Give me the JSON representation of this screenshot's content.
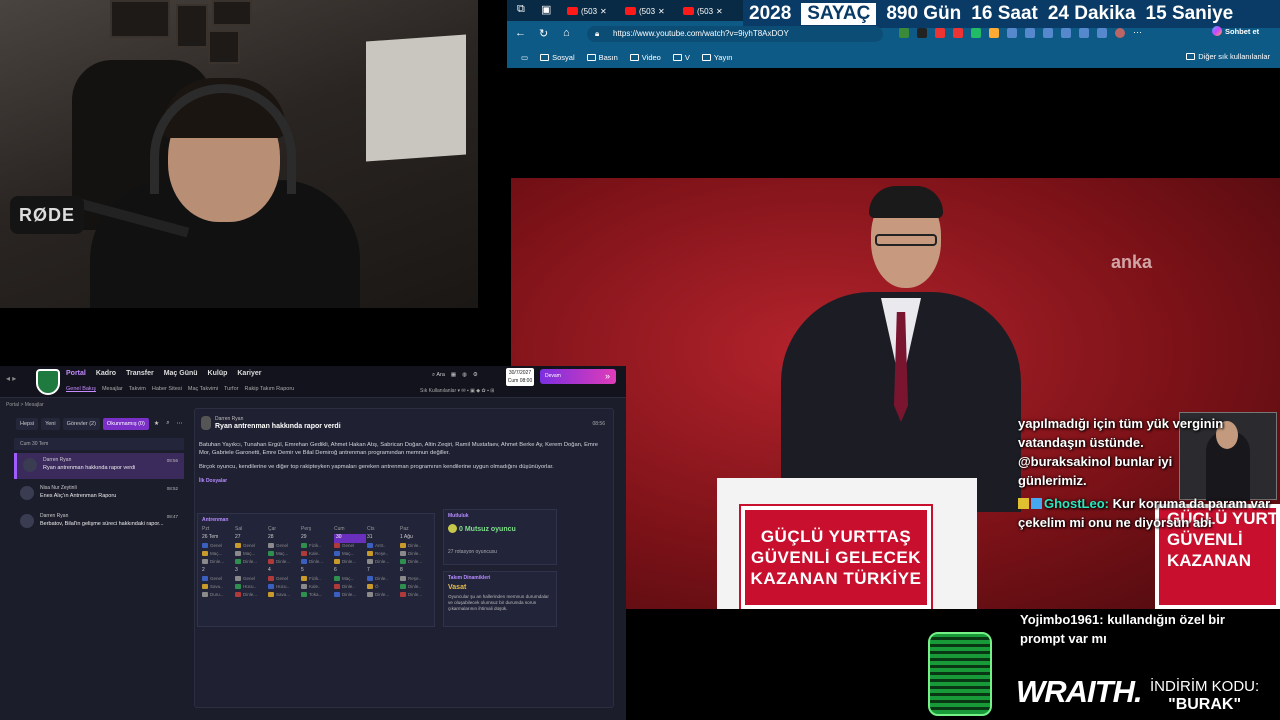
{
  "webcam": {
    "mic_brand": "RØDE"
  },
  "fm": {
    "nav": [
      "Portal",
      "Kadro",
      "Transfer",
      "Maç Günü",
      "Kulüp",
      "Kariyer"
    ],
    "subnav": [
      "Genel Bakış",
      "Mesajlar",
      "Takvim",
      "Haber Sitesi",
      "Maç Takvimi",
      "Turfor",
      "Rakip Takım Raporu"
    ],
    "search_label": "Ara",
    "date_line1": "30/7/2027",
    "date_line2": "Cum 08:00",
    "continue_label": "Devam",
    "filter_label": "Sık Kullanılanlar",
    "breadcrumb": "Portal > Mesajlar",
    "filters": [
      "Hepsi",
      "Yeni",
      "Görevler (2)",
      "Okunmamış (0)"
    ],
    "inbox_header": "Cum 30 Tem",
    "messages": [
      {
        "from": "Darren Ryan",
        "title": "Ryan antrenman hakkında rapor verdi",
        "time": "08:56",
        "selected": true
      },
      {
        "from": "Nisa Nur Zeytinli",
        "title": "Enes Alıç'ın Antrenman Raporu",
        "time": "08:52",
        "selected": false
      },
      {
        "from": "Darren Ryan",
        "title": "Berbatov, Bilal'in gelişme süreci hakkındaki rapor...",
        "time": "08:47",
        "selected": false
      }
    ],
    "detail": {
      "sender": "Darren Ryan",
      "subject": "Ryan antrenman hakkında rapor verdi",
      "time": "08:56",
      "paragraph1": "Batuhan Yayıkcı, Tunahan Ergül, Emrehan Gedikli, Ahmet Hakan Atış, Sabrican Doğan, Altin Zeqiri, Ramil Mustafaev, Ahmet Berke Ay, Kerem Doğan, Emre Mor, Gabriele Garonetti, Emre Demir ve Bilal Demiroğ antrenman programından memnun değiller.",
      "paragraph2": "Birçok oyuncu, kendilerine ve diğer top rakipteyken yapmaları gereken antrenman programının kendilerine uygun olmadığını düşünüyorlar.",
      "section": "İlk Dosyalar",
      "calendar_title": "Antrenman",
      "weekdays": [
        "Pzt",
        "Sal",
        "Çar",
        "Perş",
        "Cum",
        "Cts",
        "Paz"
      ],
      "week1": [
        "26 Tem",
        "27",
        "28",
        "29",
        "30",
        "31",
        "1 Ağu"
      ],
      "week1_slots": [
        [
          "Genel",
          "Maç...",
          "Dinle..."
        ],
        [
          "Genel",
          "Maç...",
          "Dinle..."
        ],
        [
          "Genel",
          "Maç...",
          "Dinle..."
        ],
        [
          "Fizik..",
          "Kale..",
          "Dinle..."
        ],
        [
          "Genel",
          "Maç...",
          "Dinle..."
        ],
        [
          "Antr..",
          "Reşe..",
          "Dinle..."
        ],
        [
          "Dinle..",
          "Dinle..",
          "Dinle..."
        ]
      ],
      "week2": [
        "2",
        "3",
        "4",
        "5",
        "6",
        "7",
        "8"
      ],
      "week2_slots": [
        [
          "Genel",
          "Savu..",
          "Duru..."
        ],
        [
          "Genel",
          "Hücu..",
          "Dinle..."
        ],
        [
          "Genel",
          "Hücu..",
          "Savu..."
        ],
        [
          "Fizik..",
          "Kale..",
          "Toka..."
        ],
        [
          "Maç...",
          "Dinle..",
          "Dinle..."
        ],
        [
          "Dinle..",
          "Ö",
          "Dinle..."
        ],
        [
          "Reşe..",
          "Dinle..",
          "Dinle..."
        ]
      ],
      "morale_title": "Mutluluk",
      "morale_value": "0 Mutsuz oyuncu",
      "morale_footer": "27 rotasyon oyuncusu",
      "team_title": "Takım Dinamikleri",
      "team_value": "Vasat",
      "team_desc": "Oyuncular şu an hallerinden memnun durumdalar ve oluşabilecek olumsuz bir durumda sorun çıkarmalarının ihtimali düşük."
    }
  },
  "browser": {
    "tabs": [
      "(503",
      "(503",
      "(503"
    ],
    "counter": {
      "year": "2028",
      "label": "SAYAÇ",
      "days": "890 Gün",
      "hours": "16 Saat",
      "minutes": "24 Dakika",
      "seconds": "15 Saniye"
    },
    "url": "https://www.youtube.com/watch?v=9iyhT8AxDOY",
    "chat_button": "Sohbet et",
    "bookmarks": [
      "Sosyal",
      "Basın",
      "Video",
      "V",
      "Yayın"
    ],
    "bookmarks_right": "Diğer sık kullanılanlar"
  },
  "video": {
    "watermark": "anka",
    "podium_lines": [
      "GÜÇLÜ YURTTAŞ",
      "GÜVENLİ GELECEK",
      "KAZANAN TÜRKİYE"
    ],
    "podium2_lines": [
      "GÜÇLÜ YURT",
      "GÜVENLİ",
      "KAZANAN"
    ]
  },
  "chat": {
    "line1": "yapılmadığı için tüm yük verginin",
    "line2": "vatandaşın üstünde.",
    "line3": "@buraksakinol bunlar iyi",
    "line4": "günlerimiz.",
    "user2": "GhostLeo:",
    "msg2": "Kur koruma da param var çekelim mi onu ne diyorsun abi",
    "user3": "Yojimbo1961:",
    "msg3": "kullandığın özel bir prompt var mı"
  },
  "sponsor": {
    "brand": "WRAITH.",
    "promo_label": "İNDİRİM KODU:",
    "promo_code": "\"BURAK\""
  }
}
